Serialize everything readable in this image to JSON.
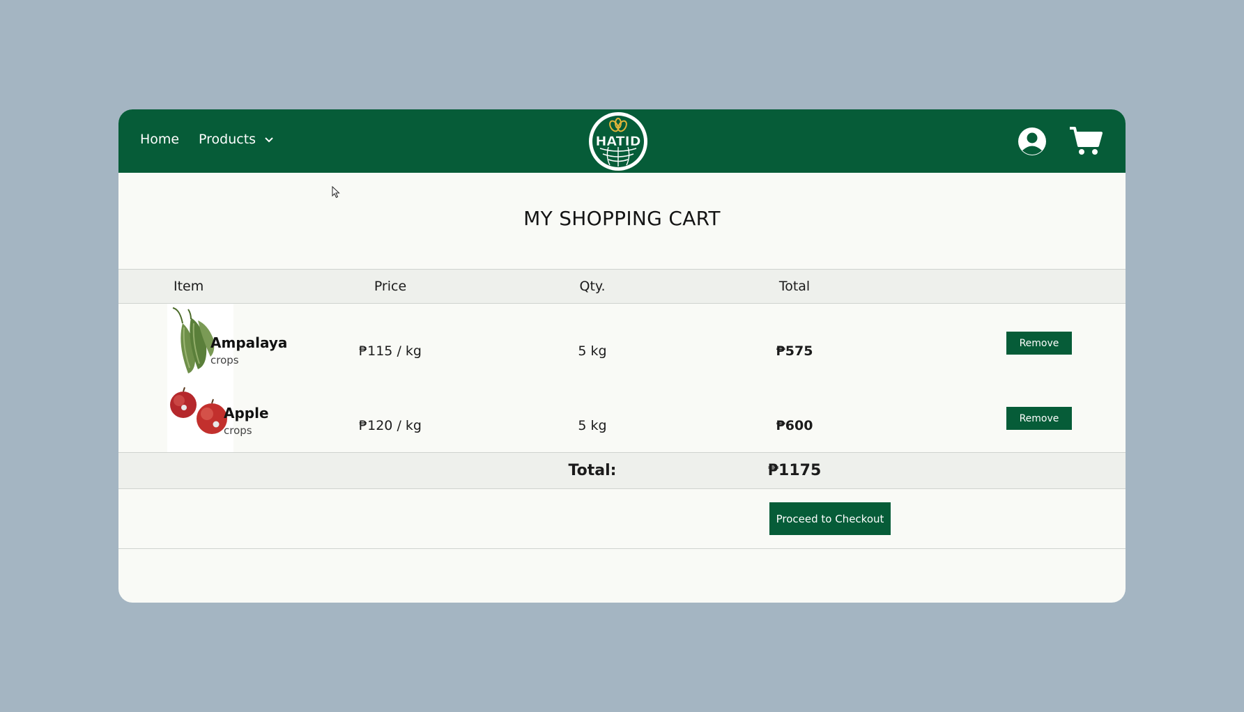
{
  "nav": {
    "home_label": "Home",
    "products_label": "Products",
    "logo_text": "HATID"
  },
  "colors": {
    "brand_green": "#065c38",
    "page_bg": "#a4b5c2",
    "panel_bg": "#f9faf6"
  },
  "icons": {
    "user": "user-circle-icon",
    "cart": "shopping-cart-icon",
    "products_dropdown": "chevron-down-icon"
  },
  "cart": {
    "title": "MY SHOPPING CART",
    "columns": {
      "item": "Item",
      "price": "Price",
      "qty": "Qty.",
      "total": "Total"
    },
    "items": [
      {
        "name": "Ampalaya",
        "category": "crops",
        "price": "₱115 / kg",
        "qty": "5 kg",
        "total": "₱575",
        "remove_label": "Remove"
      },
      {
        "name": "Apple",
        "category": "crops",
        "price": "₱120 / kg",
        "qty": "5 kg",
        "total": "₱600",
        "remove_label": "Remove"
      }
    ],
    "total_label": "Total:",
    "total_value": "₱1175",
    "checkout_label": "Proceed to Checkout"
  }
}
